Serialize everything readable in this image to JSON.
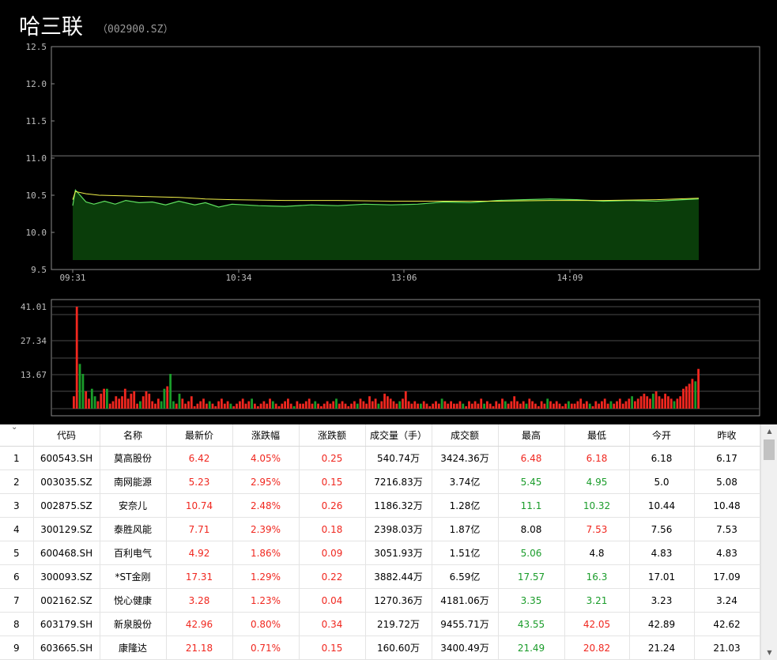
{
  "stock": {
    "name": "哈三联",
    "code": "（002900.SZ）"
  },
  "colors": {
    "up": "#f0271f",
    "down": "#1a9c2a",
    "price_line": "#5fe05f",
    "avg_line": "#f2f24a",
    "fill": "#0a3d0a",
    "grid": "#555555"
  },
  "chart_data": [
    {
      "type": "area",
      "ylim": [
        9.5,
        12.5
      ],
      "y_ticks": [
        "12.5",
        "12.0",
        "11.5",
        "11.0",
        "10.5",
        "10.0",
        "9.5"
      ],
      "x_ticks": [
        "09:31",
        "10:34",
        "13:06",
        "14:09"
      ],
      "reference_price": 11.03,
      "series": [
        {
          "name": "",
          "points": [
            [
              0,
              10.36
            ],
            [
              1,
              10.57
            ],
            [
              3,
              10.49
            ],
            [
              5,
              10.41
            ],
            [
              8,
              10.38
            ],
            [
              12,
              10.42
            ],
            [
              16,
              10.38
            ],
            [
              20,
              10.43
            ],
            [
              25,
              10.4
            ],
            [
              30,
              10.41
            ],
            [
              35,
              10.37
            ],
            [
              40,
              10.42
            ],
            [
              46,
              10.37
            ],
            [
              50,
              10.4
            ],
            [
              55,
              10.34
            ],
            [
              60,
              10.38
            ],
            [
              70,
              10.36
            ],
            [
              80,
              10.35
            ],
            [
              90,
              10.37
            ],
            [
              100,
              10.36
            ],
            [
              110,
              10.38
            ],
            [
              120,
              10.37
            ],
            [
              130,
              10.38
            ],
            [
              140,
              10.41
            ],
            [
              150,
              10.4
            ],
            [
              160,
              10.43
            ],
            [
              170,
              10.44
            ],
            [
              180,
              10.45
            ],
            [
              190,
              10.44
            ],
            [
              200,
              10.42
            ],
            [
              210,
              10.43
            ],
            [
              220,
              10.42
            ],
            [
              230,
              10.44
            ],
            [
              236,
              10.45
            ]
          ]
        },
        {
          "name": "",
          "points": [
            [
              0,
              10.44
            ],
            [
              1,
              10.55
            ],
            [
              5,
              10.52
            ],
            [
              10,
              10.5
            ],
            [
              20,
              10.49
            ],
            [
              30,
              10.48
            ],
            [
              40,
              10.47
            ],
            [
              50,
              10.45
            ],
            [
              60,
              10.44
            ],
            [
              80,
              10.43
            ],
            [
              100,
              10.43
            ],
            [
              120,
              10.42
            ],
            [
              140,
              10.42
            ],
            [
              160,
              10.42
            ],
            [
              180,
              10.43
            ],
            [
              200,
              10.43
            ],
            [
              220,
              10.44
            ],
            [
              236,
              10.46
            ]
          ]
        }
      ]
    },
    {
      "type": "bar",
      "ylim": [
        0,
        41.01
      ],
      "y_ticks": [
        "41.01",
        "27.34",
        "13.67"
      ],
      "series": [
        {
          "name": "",
          "values": [
            5,
            41,
            18,
            14,
            7,
            4,
            8,
            5,
            3,
            6,
            8,
            8,
            2,
            3,
            5,
            4,
            5,
            8,
            4,
            6,
            7,
            2,
            3,
            5,
            7,
            6,
            3,
            2,
            4,
            3,
            8,
            9,
            14,
            3,
            2,
            6,
            4,
            2,
            3,
            5,
            1,
            2,
            3,
            4,
            2,
            3,
            2,
            1,
            3,
            4,
            2,
            3,
            2,
            1,
            2,
            3,
            4,
            2,
            3,
            4,
            2,
            1,
            2,
            3,
            2,
            4,
            3,
            2,
            1,
            2,
            3,
            4,
            2,
            1,
            3,
            2,
            2,
            3,
            4,
            2,
            3,
            2,
            1,
            2,
            3,
            2,
            3,
            4,
            2,
            3,
            2,
            1,
            2,
            3,
            2,
            4,
            3,
            2,
            5,
            3,
            4,
            2,
            3,
            6,
            5,
            4,
            3,
            2,
            3,
            4,
            7,
            3,
            2,
            3,
            2,
            2,
            3,
            2,
            1,
            2,
            3,
            2,
            4,
            3,
            2,
            3,
            2,
            2,
            3,
            2,
            1,
            3,
            2,
            3,
            2,
            4,
            2,
            3,
            2,
            1,
            3,
            2,
            4,
            3,
            2,
            3,
            5,
            3,
            2,
            3,
            2,
            4,
            3,
            2,
            1,
            3,
            2,
            4,
            3,
            2,
            3,
            2,
            1,
            2,
            3,
            2,
            2,
            3,
            4,
            2,
            3,
            2,
            1,
            3,
            2,
            3,
            4,
            2,
            3,
            2,
            3,
            4,
            2,
            3,
            4,
            5,
            3,
            4,
            5,
            6,
            5,
            4,
            6,
            7,
            5,
            4,
            6,
            5,
            4,
            3,
            4,
            5,
            8,
            9,
            10,
            12,
            11,
            16
          ]
        }
      ]
    }
  ],
  "table": {
    "headers": [
      "",
      "代码",
      "名称",
      "最新价",
      "涨跌幅",
      "涨跌额",
      "成交量（手）",
      "成交额",
      "最高",
      "最低",
      "今开",
      "昨收"
    ],
    "rows": [
      {
        "idx": "1",
        "code": "600543.SH",
        "name": "莫高股份",
        "price": "6.42",
        "pct": "4.05%",
        "chg": "0.25",
        "vol": "540.74万",
        "amt": "3424.36万",
        "high": "6.48",
        "low": "6.18",
        "open": "6.18",
        "prev": "6.17",
        "hc": "up",
        "lc": "up"
      },
      {
        "idx": "2",
        "code": "003035.SZ",
        "name": "南网能源",
        "price": "5.23",
        "pct": "2.95%",
        "chg": "0.15",
        "vol": "7216.83万",
        "amt": "3.74亿",
        "high": "5.45",
        "low": "4.95",
        "open": "5.0",
        "prev": "5.08",
        "hc": "down",
        "lc": "down"
      },
      {
        "idx": "3",
        "code": "002875.SZ",
        "name": "安奈儿",
        "price": "10.74",
        "pct": "2.48%",
        "chg": "0.26",
        "vol": "1186.32万",
        "amt": "1.28亿",
        "high": "11.1",
        "low": "10.32",
        "open": "10.44",
        "prev": "10.48",
        "hc": "down",
        "lc": "down"
      },
      {
        "idx": "4",
        "code": "300129.SZ",
        "name": "泰胜风能",
        "price": "7.71",
        "pct": "2.39%",
        "chg": "0.18",
        "vol": "2398.03万",
        "amt": "1.87亿",
        "high": "8.08",
        "low": "7.53",
        "open": "7.56",
        "prev": "7.53",
        "hc": "plain",
        "lc": "up"
      },
      {
        "idx": "5",
        "code": "600468.SH",
        "name": "百利电气",
        "price": "4.92",
        "pct": "1.86%",
        "chg": "0.09",
        "vol": "3051.93万",
        "amt": "1.51亿",
        "high": "5.06",
        "low": "4.8",
        "open": "4.83",
        "prev": "4.83",
        "hc": "down",
        "lc": "plain"
      },
      {
        "idx": "6",
        "code": "300093.SZ",
        "name": "*ST金刚",
        "price": "17.31",
        "pct": "1.29%",
        "chg": "0.22",
        "vol": "3882.44万",
        "amt": "6.59亿",
        "high": "17.57",
        "low": "16.3",
        "open": "17.01",
        "prev": "17.09",
        "hc": "down",
        "lc": "down"
      },
      {
        "idx": "7",
        "code": "002162.SZ",
        "name": "悦心健康",
        "price": "3.28",
        "pct": "1.23%",
        "chg": "0.04",
        "vol": "1270.36万",
        "amt": "4181.06万",
        "high": "3.35",
        "low": "3.21",
        "open": "3.23",
        "prev": "3.24",
        "hc": "down",
        "lc": "down"
      },
      {
        "idx": "8",
        "code": "603179.SH",
        "name": "新泉股份",
        "price": "42.96",
        "pct": "0.80%",
        "chg": "0.34",
        "vol": "219.72万",
        "amt": "9455.71万",
        "high": "43.55",
        "low": "42.05",
        "open": "42.89",
        "prev": "42.62",
        "hc": "down",
        "lc": "up"
      },
      {
        "idx": "9",
        "code": "603665.SH",
        "name": "康隆达",
        "price": "21.18",
        "pct": "0.71%",
        "chg": "0.15",
        "vol": "160.60万",
        "amt": "3400.49万",
        "high": "21.49",
        "low": "20.82",
        "open": "21.24",
        "prev": "21.03",
        "hc": "down",
        "lc": "up"
      }
    ]
  },
  "icons": {
    "sort": "chevron-down-icon",
    "scroll_up": "scroll-up-arrow-icon",
    "scroll_down": "scroll-down-arrow-icon"
  }
}
